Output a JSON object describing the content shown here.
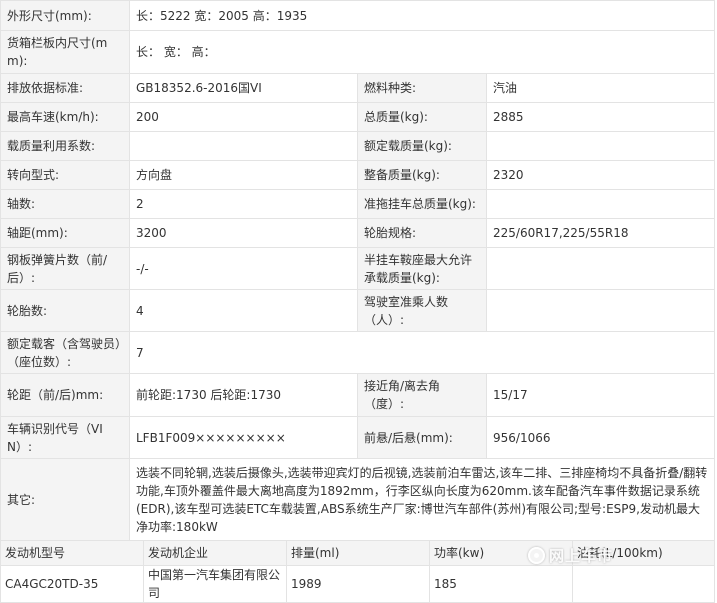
{
  "specs": [
    {
      "label": "外形尺寸(mm):",
      "value": "长：5222 宽：2005 高：1935"
    },
    {
      "label": "货箱栏板内尺寸(mm):",
      "value": "长： 宽： 高："
    },
    {
      "label": "排放依据标准:",
      "value": "GB18352.6-2016国VI",
      "label2": "燃料种类:",
      "value2": "汽油"
    },
    {
      "label": "最高车速(km/h):",
      "value": "200",
      "label2": "总质量(kg):",
      "value2": "2885"
    },
    {
      "label": "载质量利用系数:",
      "value": "",
      "label2": "额定载质量(kg):",
      "value2": ""
    },
    {
      "label": "转向型式:",
      "value": "方向盘",
      "label2": "整备质量(kg):",
      "value2": "2320"
    },
    {
      "label": "轴数:",
      "value": "2",
      "label2": "准拖挂车总质量(kg):",
      "value2": ""
    },
    {
      "label": "轴距(mm):",
      "value": "3200",
      "label2": "轮胎规格:",
      "value2": "225/60R17,225/55R18"
    },
    {
      "label": "钢板弹簧片数（前/后）:",
      "value": "-/-",
      "label2": "半挂车鞍座最大允许承载质量(kg):",
      "value2": ""
    },
    {
      "label": "轮胎数:",
      "value": "4",
      "label2": "驾驶室准乘人数（人）:",
      "value2": ""
    },
    {
      "label": "额定载客（含驾驶员）（座位数）:",
      "value": "7"
    },
    {
      "label": "轮距（前/后)mm:",
      "value": "前轮距:1730 后轮距:1730",
      "label2": "接近角/离去角（度）:",
      "value2": "15/17"
    },
    {
      "label": "车辆识别代号（VIN）:",
      "value": "LFB1F009×××××××××",
      "label2": "前悬/后悬(mm):",
      "value2": "956/1066"
    },
    {
      "label": "其它:",
      "value": "选装不同轮辋,选装后摄像头,选装带迎宾灯的后视镜,选装前泊车雷达,该车二排、三排座椅均不具备折叠/翻转功能,车顶外覆盖件最大离地高度为1892mm，行李区纵向长度为620mm.该车配备汽车事件数据记录系统(EDR),该车型可选装ETC车载装置,ABS系统生产厂家:博世汽车部件(苏州)有限公司;型号:ESP9,发动机最大净功率:180kW"
    }
  ],
  "engine": {
    "headers": [
      "发动机型号",
      "发动机企业",
      "排量(ml)",
      "功率(kw)",
      "油耗(L/100km)"
    ],
    "row": [
      "CA4GC20TD-35",
      "中国第一汽车集团有限公司",
      "1989",
      "185",
      ""
    ]
  },
  "watermark": {
    "text": "网上车市"
  }
}
